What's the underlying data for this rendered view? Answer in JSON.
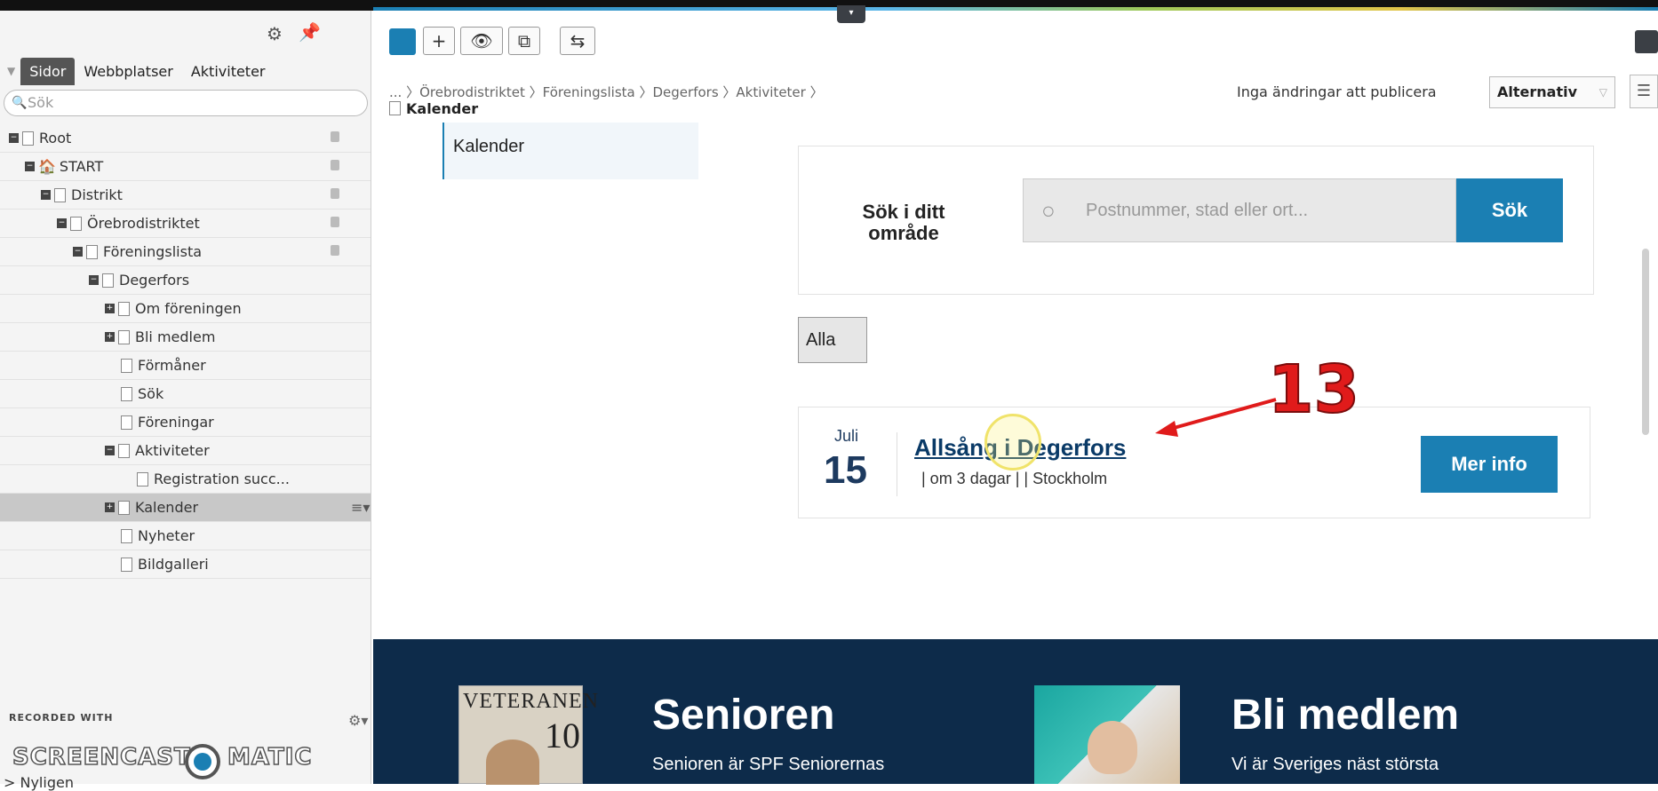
{
  "left_panel": {
    "tabs": [
      "Sidor",
      "Webbplatser",
      "Aktiviteter"
    ],
    "search_placeholder": "Sök",
    "tree": [
      {
        "label": "Root",
        "indent": 0,
        "toggle": "minus",
        "locked": true,
        "page": true
      },
      {
        "label": "START",
        "indent": 1,
        "toggle": "minus",
        "locked": true,
        "page": false
      },
      {
        "label": "Distrikt",
        "indent": 2,
        "toggle": "minus",
        "locked": true,
        "page": true
      },
      {
        "label": "Örebrodistriktet",
        "indent": 3,
        "toggle": "minus",
        "locked": true,
        "page": true
      },
      {
        "label": "Föreningslista",
        "indent": 4,
        "toggle": "minus",
        "locked": true,
        "page": true
      },
      {
        "label": "Degerfors",
        "indent": 5,
        "toggle": "minus",
        "locked": false,
        "page": true
      },
      {
        "label": "Om föreningen",
        "indent": 6,
        "toggle": "plus",
        "locked": false,
        "page": true
      },
      {
        "label": "Bli medlem",
        "indent": 6,
        "toggle": "plus",
        "locked": false,
        "page": true
      },
      {
        "label": "Förmåner",
        "indent": 7,
        "toggle": "none",
        "locked": false,
        "page": true
      },
      {
        "label": "Sök",
        "indent": 7,
        "toggle": "none",
        "locked": false,
        "page": true
      },
      {
        "label": "Föreningar",
        "indent": 7,
        "toggle": "none",
        "locked": false,
        "page": true
      },
      {
        "label": "Aktiviteter",
        "indent": 6,
        "toggle": "minus",
        "locked": false,
        "page": true
      },
      {
        "label": "Registration succ...",
        "indent": 8,
        "toggle": "none",
        "locked": false,
        "page": true
      },
      {
        "label": "Kalender",
        "indent": 6,
        "toggle": "plus",
        "locked": false,
        "page": true,
        "selected": true
      },
      {
        "label": "Nyheter",
        "indent": 7,
        "toggle": "none",
        "locked": false,
        "page": true
      },
      {
        "label": "Bildgalleri",
        "indent": 7,
        "toggle": "none",
        "locked": false,
        "page": true
      }
    ],
    "recorded_with": "RECORDED WITH",
    "screencast_1": "SCREENCAST",
    "screencast_2": "MATIC",
    "recent": "> Nyligen"
  },
  "header": {
    "breadcrumb": "... 〉Örebrodistriktet 〉Föreningslista 〉Degerfors 〉Aktiviteter 〉",
    "current_page": "Kalender",
    "publish_status": "Inga ändringar att publicera",
    "options_label": "Alternativ"
  },
  "content": {
    "nav_item": "Kalender",
    "search_label": "Sök i ditt område",
    "search_placeholder": "Postnummer, stad eller ort...",
    "search_button": "Sök",
    "filter_button": "Alla",
    "event": {
      "month": "Juli",
      "day": "15",
      "title": "Allsång i Degerfors",
      "meta": "| om 3 dagar |  | Stockholm",
      "button": "Mer info"
    },
    "annotation_number": "13",
    "footer": {
      "magazine_title": "VETERANEN",
      "magazine_number": "10",
      "col1_heading": "Senioren",
      "col1_text": "Senioren är SPF Seniorernas",
      "col2_heading": "Bli medlem",
      "col2_text": "Vi är Sveriges näst största"
    }
  },
  "colors": {
    "accent": "#1b7fb3",
    "footer_bg": "#0d2b4a",
    "annotation": "#e01b1b"
  }
}
